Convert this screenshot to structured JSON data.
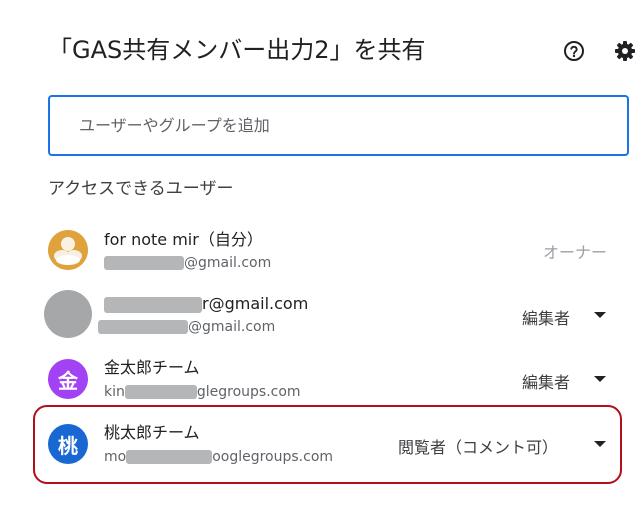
{
  "dialog": {
    "title": "「GAS共有メンバー出力2」を共有",
    "help_icon": "help-icon",
    "settings_icon": "gear-icon"
  },
  "add_people": {
    "placeholder": "ユーザーやグループを追加"
  },
  "access_section": {
    "label": "アクセスできるユーザー"
  },
  "people": [
    {
      "name": "for note mir（自分）",
      "email_visible": "@gmail.com",
      "role": "オーナー",
      "avatar_color": "#e0a23d"
    },
    {
      "name_visible": "r@gmail.com",
      "email_visible": "@gmail.com",
      "role": "編集者",
      "avatar_color": "#a6a7a9"
    },
    {
      "name": "金太郎チーム",
      "email_prefix": "kin",
      "email_suffix": "glegroups.com",
      "role": "編集者",
      "avatar_letter": "金",
      "avatar_color": "#a142f4"
    },
    {
      "name": "桃太郎チーム",
      "email_prefix": "mo",
      "email_suffix": "ooglegroups.com",
      "role": "閲覧者（コメント可）",
      "avatar_letter": "桃",
      "avatar_color": "#1967d2"
    }
  ],
  "colors": {
    "accent": "#1a73e8",
    "highlight": "#b00f1c"
  }
}
